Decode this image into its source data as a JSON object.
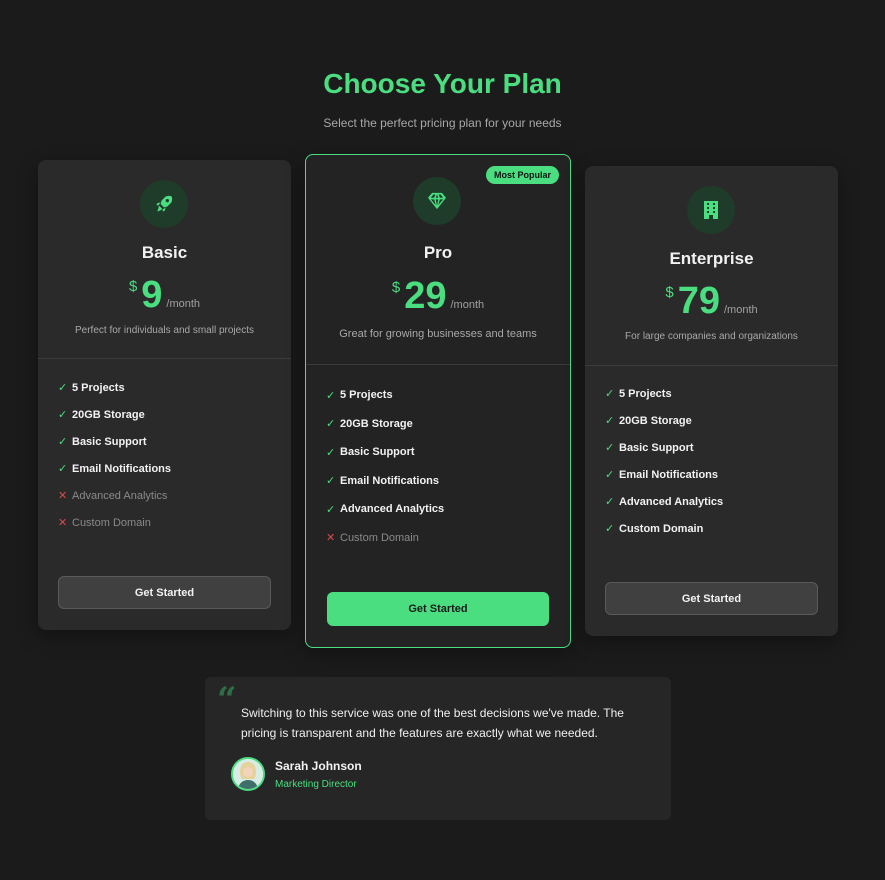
{
  "header": {
    "title": "Choose Your Plan",
    "subtitle": "Select the perfect pricing plan for your needs"
  },
  "colors": {
    "accent": "#4ade80",
    "background": "#1b1b1b",
    "card": "#2a2a2a",
    "negative": "#d94a4a"
  },
  "plans": [
    {
      "icon": "rocket-icon",
      "name": "Basic",
      "currency": "$",
      "amount": "9",
      "period": "/month",
      "description": "Perfect for individuals and small projects",
      "features": [
        {
          "label": "5 Projects",
          "included": true
        },
        {
          "label": "20GB Storage",
          "included": true
        },
        {
          "label": "Basic Support",
          "included": true
        },
        {
          "label": "Email Notifications",
          "included": true
        },
        {
          "label": "Advanced Analytics",
          "included": false
        },
        {
          "label": "Custom Domain",
          "included": false
        }
      ],
      "cta": "Get Started"
    },
    {
      "icon": "gem-icon",
      "name": "Pro",
      "badge": "Most Popular",
      "currency": "$",
      "amount": "29",
      "period": "/month",
      "description": "Great for growing businesses and teams",
      "features": [
        {
          "label": "5 Projects",
          "included": true
        },
        {
          "label": "20GB Storage",
          "included": true
        },
        {
          "label": "Basic Support",
          "included": true
        },
        {
          "label": "Email Notifications",
          "included": true
        },
        {
          "label": "Advanced Analytics",
          "included": true
        },
        {
          "label": "Custom Domain",
          "included": false
        }
      ],
      "cta": "Get Started"
    },
    {
      "icon": "building-icon",
      "name": "Enterprise",
      "currency": "$",
      "amount": "79",
      "period": "/month",
      "description": "For large companies and organizations",
      "features": [
        {
          "label": "5 Projects",
          "included": true
        },
        {
          "label": "20GB Storage",
          "included": true
        },
        {
          "label": "Basic Support",
          "included": true
        },
        {
          "label": "Email Notifications",
          "included": true
        },
        {
          "label": "Advanced Analytics",
          "included": true
        },
        {
          "label": "Custom Domain",
          "included": true
        }
      ],
      "cta": "Get Started"
    }
  ],
  "testimonial": {
    "quote_icon": "quote-icon",
    "text": "Switching to this service was one of the best decisions we've made. The pricing is transparent and the features are exactly what we needed.",
    "author": "Sarah Johnson",
    "role": "Marketing Director"
  }
}
